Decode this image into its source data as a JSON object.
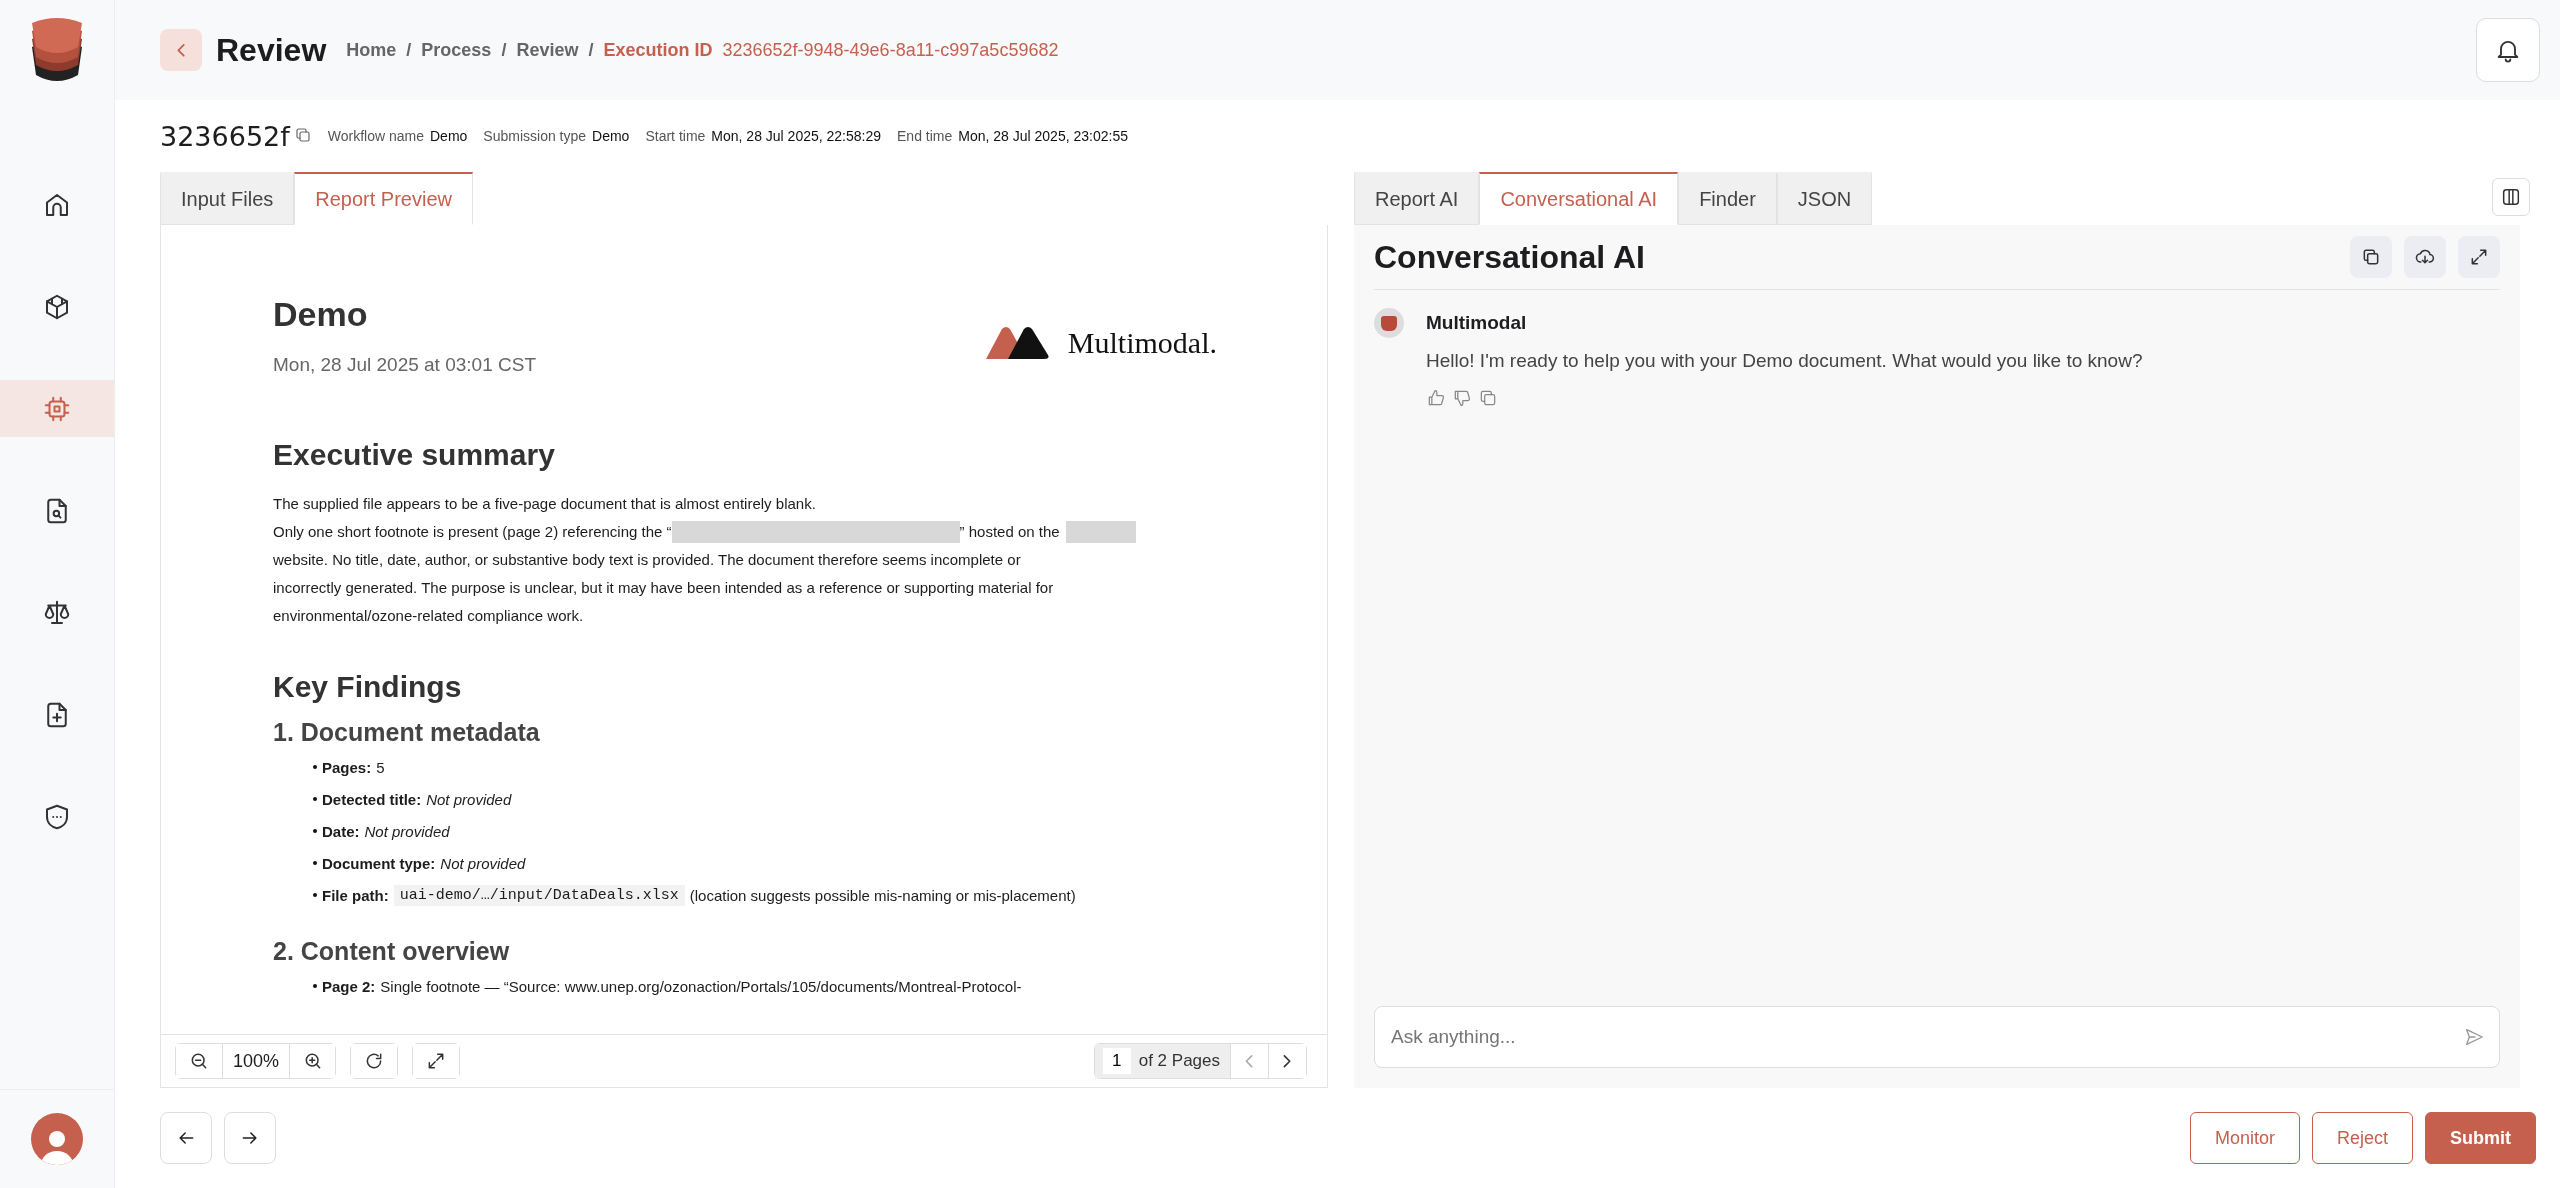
{
  "sidebar": {
    "items": [
      {
        "kind": "home",
        "selected": false
      },
      {
        "kind": "cube",
        "selected": false
      },
      {
        "kind": "chip",
        "selected": true
      },
      {
        "kind": "file-search",
        "selected": false
      },
      {
        "kind": "scale",
        "selected": false
      },
      {
        "kind": "file-plus",
        "selected": false
      },
      {
        "kind": "shield",
        "selected": false
      }
    ]
  },
  "header": {
    "title": "Review",
    "breadcrumb": [
      {
        "text": "Home",
        "current": false
      },
      {
        "text": "Process",
        "current": false
      },
      {
        "text": "Review",
        "current": false
      },
      {
        "label": "Execution ID",
        "text": "3236652f-9948-49e6-8a11-c997a5c59682",
        "current": true
      }
    ],
    "separator": "/"
  },
  "execution": {
    "short_id": "3236652f",
    "meta": [
      {
        "label": "Workflow name",
        "value": "Demo"
      },
      {
        "label": "Submission type",
        "value": "Demo"
      },
      {
        "label": "Start time",
        "value": "Mon, 28 Jul 2025, 22:58:29"
      },
      {
        "label": "End time",
        "value": "Mon, 28 Jul 2025, 23:02:55"
      }
    ]
  },
  "left_panel": {
    "tabs": [
      {
        "label": "Input Files",
        "selected": false
      },
      {
        "label": "Report Preview",
        "selected": true
      }
    ],
    "document": {
      "title": "Demo",
      "date": "Mon, 28 Jul 2025 at 03:01 CST",
      "logo_text": "Multimodal.",
      "sections": [
        {
          "kind": "heading",
          "text": "Executive summary"
        },
        {
          "kind": "paragraph",
          "lines": [
            [
              {
                "kind": "text",
                "text": "The supplied file appears to be a five-page document that is almost entirely blank."
              }
            ],
            [
              {
                "kind": "text",
                "text": "Only one short footnote is present (page 2) referencing the “"
              },
              {
                "kind": "redacted-long"
              },
              {
                "kind": "text",
                "text": "” hosted on the"
              },
              {
                "kind": "redacted-short"
              }
            ],
            [
              {
                "kind": "text",
                "text": "website. No title, date, author, or substantive body text is provided. The document therefore seems incomplete or"
              }
            ],
            [
              {
                "kind": "text",
                "text": "incorrectly generated. The purpose is unclear, but it may have been intended as a reference or supporting material for"
              }
            ],
            [
              {
                "kind": "text",
                "text": "environmental/ozone-related compliance work."
              }
            ]
          ]
        },
        {
          "kind": "heading",
          "text": "Key Findings"
        },
        {
          "kind": "subheading",
          "text": "1. Document metadata"
        },
        {
          "kind": "bullets",
          "items": [
            {
              "label": "Pages:",
              "parts": [
                {
                  "kind": "plain",
                  "text": "5"
                }
              ]
            },
            {
              "label": "Detected title:",
              "parts": [
                {
                  "kind": "italic",
                  "text": "Not provided"
                }
              ]
            },
            {
              "label": "Date:",
              "parts": [
                {
                  "kind": "italic",
                  "text": "Not provided"
                }
              ]
            },
            {
              "label": "Document type:",
              "parts": [
                {
                  "kind": "italic",
                  "text": "Not provided"
                }
              ]
            },
            {
              "label": "File path:",
              "parts": [
                {
                  "kind": "code",
                  "text": "uai-demo/…/input/DataDeals.xlsx"
                },
                {
                  "kind": "plain",
                  "text": "(location suggests possible mis-naming or mis-placement)"
                }
              ]
            }
          ]
        },
        {
          "kind": "subheading",
          "text": "2. Content overview"
        },
        {
          "kind": "bullets",
          "items": [
            {
              "label": "Page 2:",
              "parts": [
                {
                  "kind": "plain",
                  "text": "Single footnote — “Source: www.unep.org/ozonaction/Portals/105/documents/Montreal-Protocol-"
                }
              ]
            }
          ]
        }
      ]
    },
    "toolbar": {
      "zoom": "100%",
      "page": "1",
      "page_total": "of 2 Pages"
    }
  },
  "right_panel": {
    "tabs": [
      {
        "label": "Report AI",
        "selected": false
      },
      {
        "label": "Conversational AI",
        "selected": true
      },
      {
        "label": "Finder",
        "selected": false
      },
      {
        "label": "JSON",
        "selected": false
      }
    ],
    "title": "Conversational AI",
    "messages": [
      {
        "sender": "Multimodal",
        "text": "Hello! I'm ready to help you with your Demo document. What would you like to know?"
      }
    ],
    "input": {
      "placeholder": "Ask anything..."
    }
  },
  "footer": {
    "buttons": [
      {
        "label": "Monitor",
        "kind": "outline"
      },
      {
        "label": "Reject",
        "kind": "outline"
      },
      {
        "label": "Submit",
        "kind": "primary"
      }
    ]
  }
}
